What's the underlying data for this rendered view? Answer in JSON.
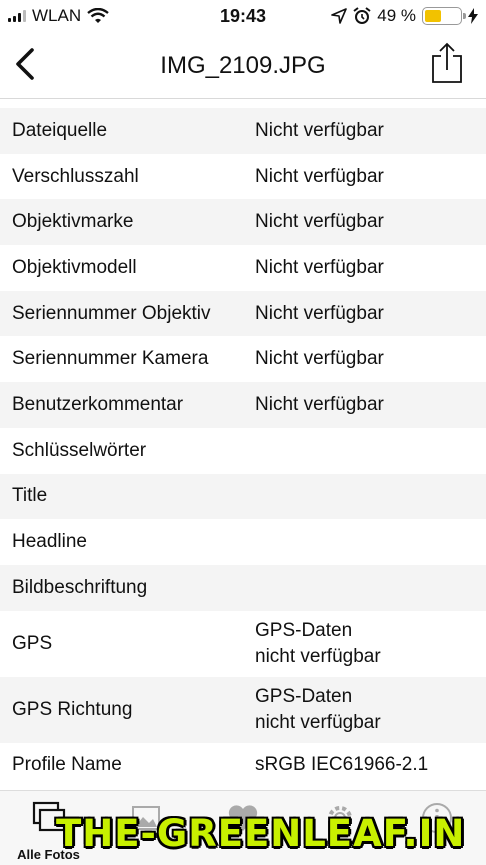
{
  "status": {
    "carrier": "WLAN",
    "time": "19:43",
    "battery": "49 %",
    "battery_level": 0.49
  },
  "nav": {
    "title": "IMG_2109.JPG"
  },
  "rows": [
    {
      "key": "Dateiquelle",
      "value": "Nicht verfügbar"
    },
    {
      "key": "Verschlusszahl",
      "value": "Nicht verfügbar"
    },
    {
      "key": "Objektivmarke",
      "value": "Nicht verfügbar"
    },
    {
      "key": "Objektivmodell",
      "value": "Nicht verfügbar"
    },
    {
      "key": "Seriennummer Objektiv",
      "value": "Nicht verfügbar"
    },
    {
      "key": "Seriennummer Kamera",
      "value": "Nicht verfügbar"
    },
    {
      "key": "Benutzerkommentar",
      "value": "Nicht verfügbar"
    },
    {
      "key": "Schlüsselwörter",
      "value": ""
    },
    {
      "key": "Title",
      "value": ""
    },
    {
      "key": "Headline",
      "value": ""
    },
    {
      "key": "Bildbeschriftung",
      "value": ""
    },
    {
      "key": "GPS",
      "value": "GPS-Daten",
      "value2": "nicht verfügbar"
    },
    {
      "key": "GPS Richtung",
      "value": "GPS-Daten",
      "value2": "nicht verfügbar"
    },
    {
      "key": "Profile Name",
      "value": "sRGB IEC61966-2.1"
    }
  ],
  "tabs": {
    "all_photos": "Alle Fotos"
  },
  "watermark": "THE-GREENLEAF.IN"
}
